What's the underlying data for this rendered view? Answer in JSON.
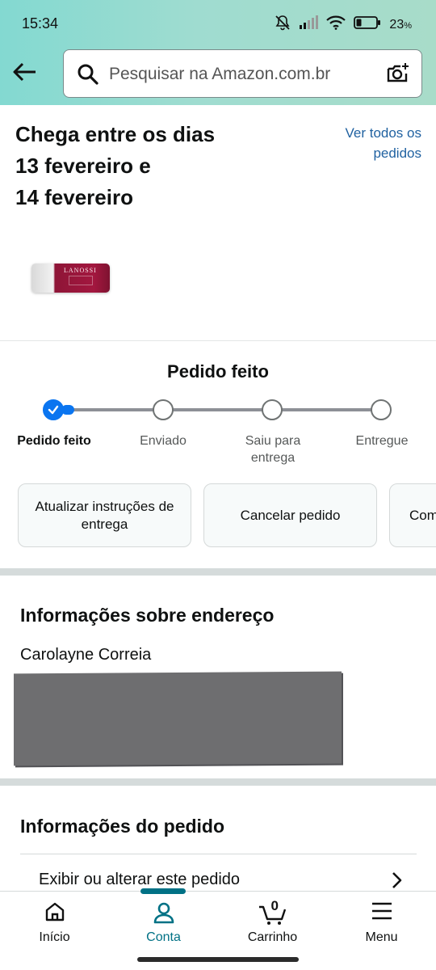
{
  "status_bar": {
    "time": "15:34",
    "battery": "23",
    "battery_unit": "%",
    "icons": [
      "mute-icon",
      "signal-icon",
      "wifi-icon",
      "battery-icon"
    ]
  },
  "header": {
    "back_icon": "arrow-left-icon",
    "search_placeholder": "Pesquisar na Amazon.com.br",
    "search_icon": "search-icon",
    "camera_icon": "camera-icon"
  },
  "delivery": {
    "line1": "Chega entre os dias",
    "line2": "13 fevereiro e",
    "line3": "14 fevereiro",
    "view_all_label": "Ver todos os pedidos"
  },
  "product": {
    "brand_text": "LANOSSI"
  },
  "tracking": {
    "title": "Pedido feito",
    "current_step": 1,
    "steps": [
      {
        "label": "Pedido feito"
      },
      {
        "label": "Enviado"
      },
      {
        "label": "Saiu para entrega"
      },
      {
        "label": "Entregue"
      }
    ]
  },
  "actions": [
    {
      "label": "Atualizar instruções de entrega"
    },
    {
      "label": "Cancelar pedido"
    },
    {
      "label": "Com"
    }
  ],
  "address": {
    "title": "Informações sobre endereço",
    "name": "Carolayne Correia"
  },
  "order_info": {
    "title": "Informações do pedido",
    "link_label": "Exibir ou alterar este pedido",
    "chevron_icon": "chevron-right-icon"
  },
  "bottom_nav": {
    "active": "Conta",
    "items": [
      {
        "label": "Início",
        "icon": "home-icon"
      },
      {
        "label": "Conta",
        "icon": "user-icon"
      },
      {
        "label": "Carrinho",
        "icon": "cart-icon",
        "badge": "0"
      },
      {
        "label": "Menu",
        "icon": "menu-icon"
      }
    ]
  },
  "colors": {
    "header_gradient_start": "#83d9d1",
    "header_gradient_end": "#a8dcc9",
    "link": "#2162a1",
    "progress_active": "#0a75f0",
    "nav_active": "#007185"
  }
}
